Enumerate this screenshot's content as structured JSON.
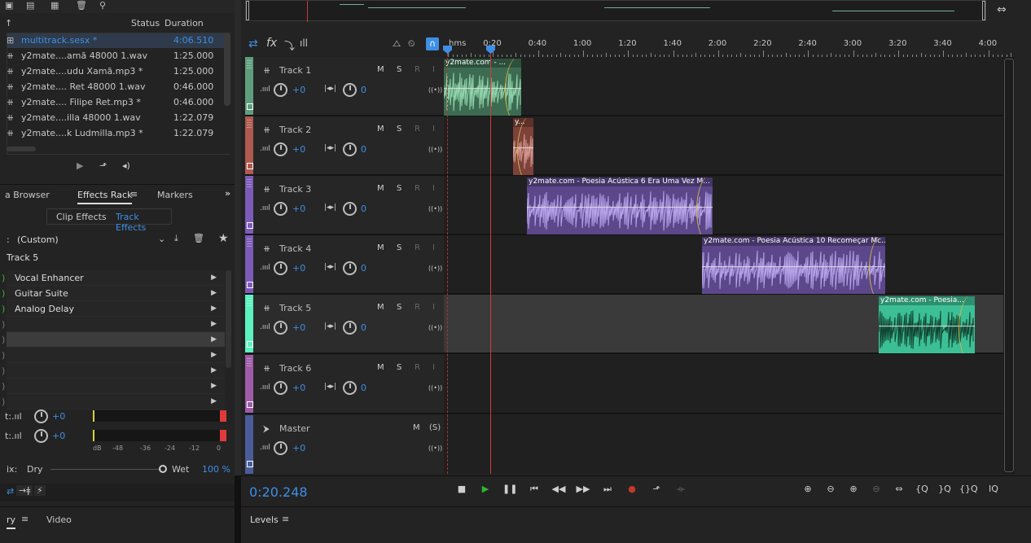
{
  "files": {
    "header_status": "Status",
    "header_duration": "Duration",
    "rows": [
      {
        "name": "multitrack.sesx *",
        "duration": "4:06.510",
        "selected": true
      },
      {
        "name": "y2mate....amã 48000 1.wav",
        "duration": "1:25.000"
      },
      {
        "name": "y2mate....udu Xamã.mp3 *",
        "duration": "1:25.000"
      },
      {
        "name": "y2mate.... Ret 48000 1.wav",
        "duration": "0:46.000"
      },
      {
        "name": "y2mate.... Filipe Ret.mp3 *",
        "duration": "0:46.000"
      },
      {
        "name": "y2mate....illa 48000 1.wav",
        "duration": "1:22.079"
      },
      {
        "name": "y2mate....k Ludmilla.mp3 *",
        "duration": "1:22.079"
      }
    ]
  },
  "panel_tabs": {
    "media_browser": "a Browser",
    "effects_rack": "Effects Rack",
    "markers": "Markers"
  },
  "subtabs": {
    "clip_effects": "Clip Effects",
    "track_effects": "Track Effects"
  },
  "preset": "(Custom)",
  "rack_track": "Track 5",
  "effects": [
    "Vocal Enhancer",
    "Guitar Suite",
    "Analog Delay",
    "",
    "",
    "",
    "",
    "",
    ""
  ],
  "levels": {
    "input_value": "+0",
    "output_value": "+0",
    "ticks": [
      "dB",
      "-48",
      "-36",
      "-24",
      "-12",
      "0"
    ]
  },
  "mix": {
    "label": "ix:",
    "dry": "Dry",
    "wet": "Wet",
    "percent": "100 %"
  },
  "bottom_tabs": {
    "history": "ry",
    "video": "Video",
    "levels": "Levels"
  },
  "ruler": {
    "unit": "hms",
    "labels": [
      "0:20",
      "0:40",
      "1:00",
      "1:20",
      "1:40",
      "2:00",
      "2:20",
      "2:40",
      "3:00",
      "3:20",
      "3:40",
      "4:00"
    ]
  },
  "tracks": [
    {
      "name": "Track 1",
      "color": "#5f9e7d",
      "vol": "+0",
      "pan": "0"
    },
    {
      "name": "Track 2",
      "color": "#b0594f",
      "vol": "+0",
      "pan": "0"
    },
    {
      "name": "Track 3",
      "color": "#7c5bb8",
      "vol": "+0",
      "pan": "0"
    },
    {
      "name": "Track 4",
      "color": "#7c5bb8",
      "vol": "+0",
      "pan": "0"
    },
    {
      "name": "Track 5",
      "color": "#5cf2c0",
      "vol": "+0",
      "pan": "0"
    },
    {
      "name": "Track 6",
      "color": "#a05ba8",
      "vol": "+0",
      "pan": "0"
    }
  ],
  "master": {
    "name": "Master",
    "vol": "+0"
  },
  "track_buttons": {
    "m": "M",
    "s": "S",
    "r": "R",
    "i": "I",
    "master_s": "(S)"
  },
  "clips": {
    "c1": "y2mate.com - ...",
    "c2": "y...",
    "c3": "y2mate.com - Poesia Acústica 6  Era Uma Vez  M...",
    "c4": "y2mate.com - Poesia Acústica 10 Recomeçar Mc...",
    "c5": "y2mate.com - Poesia..."
  },
  "time": "0:20.248",
  "colors": {
    "accent": "#3e8ee6",
    "playhead": "#d43b3b",
    "play": "#2eb82e",
    "record": "#c0392b"
  }
}
